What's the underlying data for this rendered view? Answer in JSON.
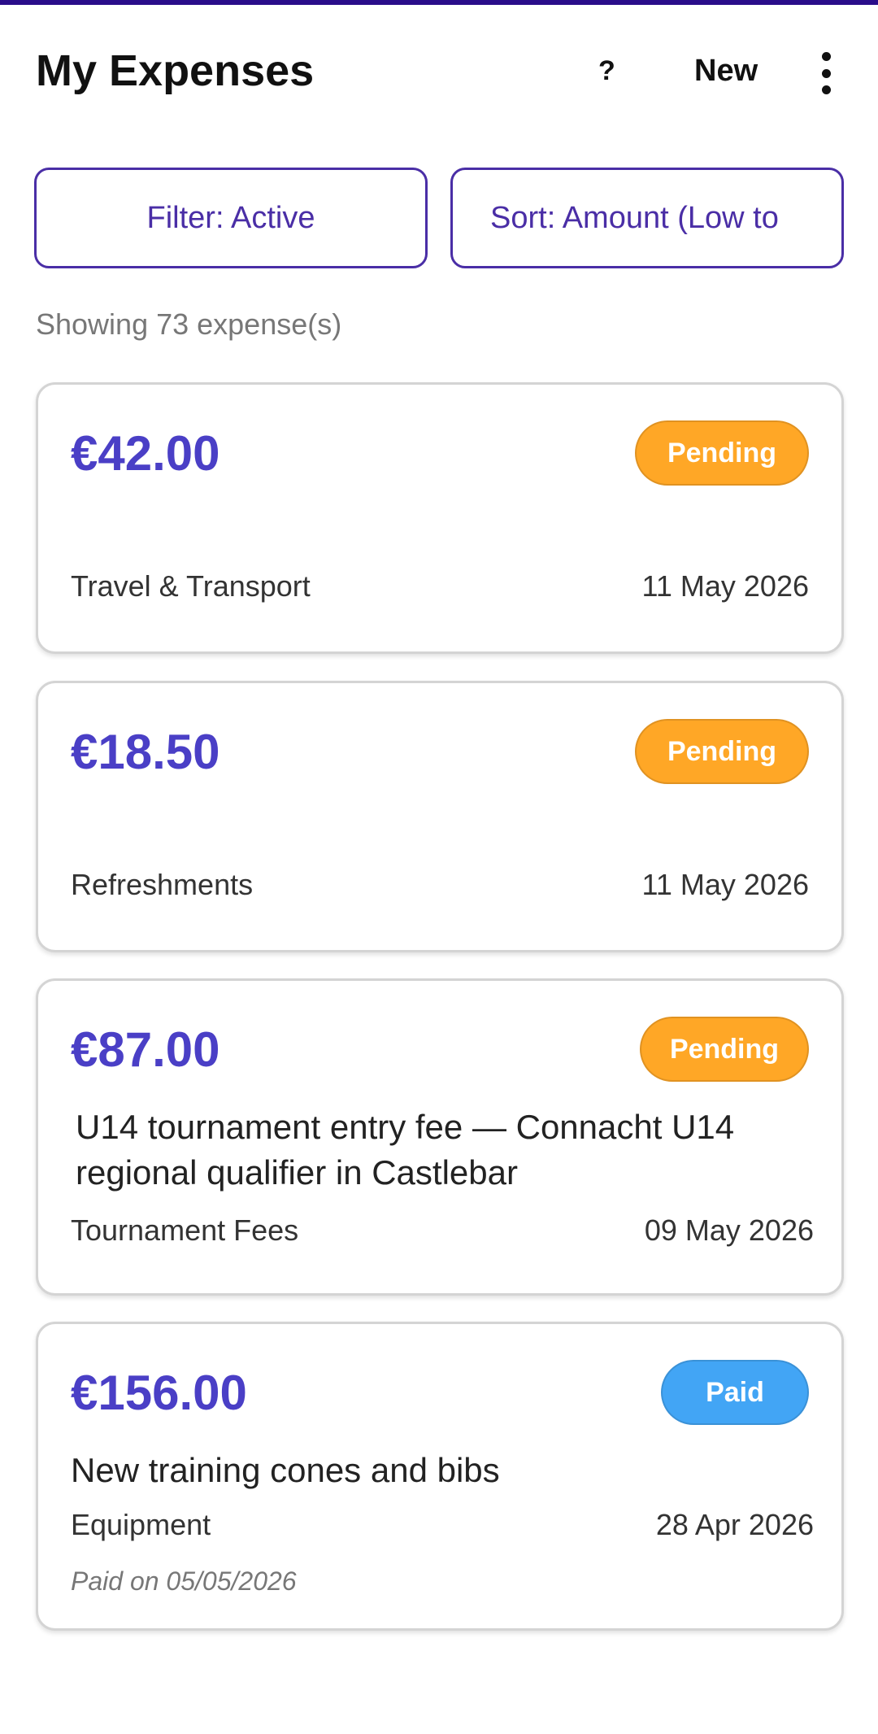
{
  "header": {
    "title": "My Expenses",
    "help_label": "?",
    "new_label": "New",
    "more_icon": "more-vertical-icon"
  },
  "controls": {
    "filter_label": "Filter: Active",
    "sort_label": "Sort: Amount (Low to"
  },
  "summary": {
    "count_text": "Showing 73 expense(s)"
  },
  "colors": {
    "accent": "#4a2ea6",
    "amount": "#4a3fc6",
    "pending": "#ffa726",
    "paid": "#42a5f5"
  },
  "expenses": [
    {
      "amount": "€42.00",
      "status": "Pending",
      "description": "",
      "category": "Travel & Transport",
      "date": "11 May 2026"
    },
    {
      "amount": "€18.50",
      "status": "Pending",
      "description": "",
      "category": "Refreshments",
      "date": "11 May 2026"
    },
    {
      "amount": "€87.00",
      "status": "Pending",
      "description": "U14 tournament entry fee — Connacht U14 regional qualifier in Castlebar",
      "category": "Tournament Fees",
      "date": "09 May 2026"
    },
    {
      "amount": "€156.00",
      "status": "Paid",
      "description": "New training cones and bibs",
      "category": "Equipment",
      "date": "28 Apr 2026",
      "paid_on": "Paid on 05/05/2026"
    }
  ]
}
